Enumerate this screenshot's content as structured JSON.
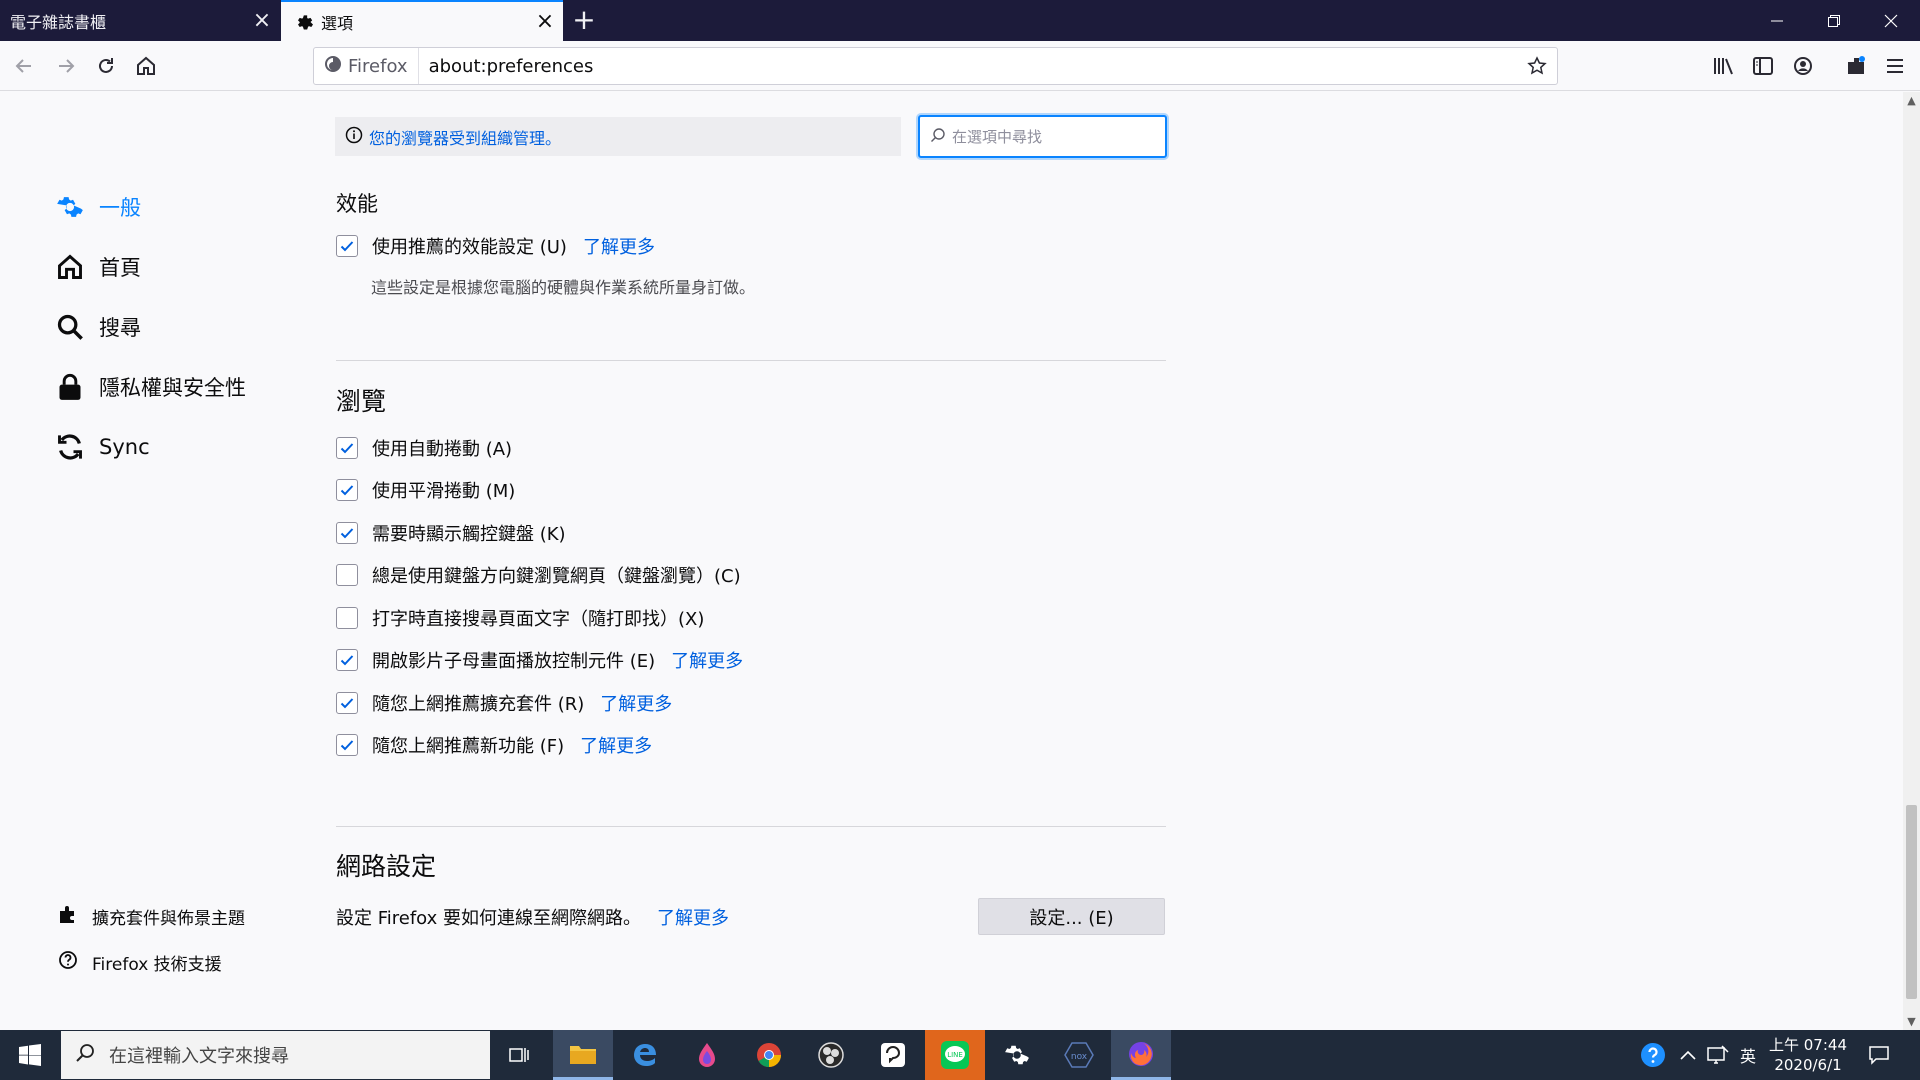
{
  "tabs": [
    {
      "label": "電子雜誌書櫃",
      "active": false
    },
    {
      "label": "選項",
      "active": true
    }
  ],
  "toolbar": {
    "identity_label": "Firefox",
    "url": "about:preferences"
  },
  "sidebar": {
    "items": [
      {
        "label": "一般",
        "icon": "gear-icon",
        "selected": true
      },
      {
        "label": "首頁",
        "icon": "home-icon",
        "selected": false
      },
      {
        "label": "搜尋",
        "icon": "search-icon",
        "selected": false
      },
      {
        "label": "隱私權與安全性",
        "icon": "lock-icon",
        "selected": false
      },
      {
        "label": "Sync",
        "icon": "sync-icon",
        "selected": false
      }
    ],
    "footer": [
      {
        "label": "擴充套件與佈景主題",
        "icon": "puzzle-icon"
      },
      {
        "label": "Firefox 技術支援",
        "icon": "help-icon"
      }
    ]
  },
  "notice": "您的瀏覽器受到組織管理。",
  "search": {
    "placeholder": "在選項中尋找"
  },
  "performance": {
    "heading": "效能",
    "recommended_label": "使用推薦的效能設定 (U)",
    "recommended_checked": true,
    "learn_more": "了解更多",
    "description": "這些設定是根據您電腦的硬體與作業系統所量身訂做。"
  },
  "browsing": {
    "heading": "瀏覽",
    "options": [
      {
        "label": "使用自動捲動 (A)",
        "checked": true,
        "link": ""
      },
      {
        "label": "使用平滑捲動 (M)",
        "checked": true,
        "link": ""
      },
      {
        "label": "需要時顯示觸控鍵盤 (K)",
        "checked": true,
        "link": ""
      },
      {
        "label": "總是使用鍵盤方向鍵瀏覽網頁（鍵盤瀏覽）(C)",
        "checked": false,
        "link": ""
      },
      {
        "label": "打字時直接搜尋頁面文字（隨打即找）(X)",
        "checked": false,
        "link": ""
      },
      {
        "label": "開啟影片子母畫面播放控制元件 (E)",
        "checked": true,
        "link": "了解更多"
      },
      {
        "label": "隨您上網推薦擴充套件 (R)",
        "checked": true,
        "link": "了解更多"
      },
      {
        "label": "隨您上網推薦新功能 (F)",
        "checked": true,
        "link": "了解更多"
      }
    ]
  },
  "network": {
    "heading": "網路設定",
    "description": "設定 Firefox 要如何連線至網際網路。",
    "learn_more": "了解更多",
    "button": "設定... (E)"
  },
  "taskbar": {
    "search_placeholder": "在這裡輸入文字來搜尋",
    "ime": "英",
    "time": "上午 07:44",
    "date": "2020/6/1"
  },
  "colors": {
    "accent": "#0a84ff",
    "link": "#0060df",
    "tabbar": "#1c1b3a",
    "taskbar": "#1f2a3a"
  }
}
